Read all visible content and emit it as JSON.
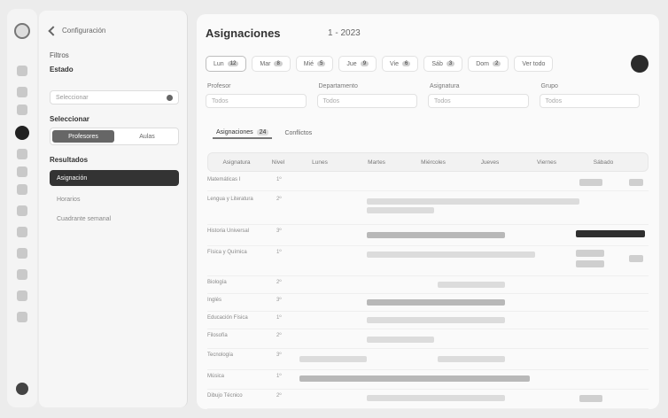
{
  "panel": {
    "back_label": "Configuración",
    "filters_label": "Filtros",
    "status_label": "Estado",
    "select_placeholder": "Seleccionar",
    "personal_label": "Seleccionar",
    "seg_left": "Profesores",
    "seg_right": "Aulas",
    "menu_title": "Resultados",
    "menu_items": [
      "Asignación",
      "Horarios",
      "Cuadrante semanal"
    ]
  },
  "main": {
    "title": "Asignaciones",
    "year": "1 - 2023",
    "tabs": [
      {
        "label": "Lun",
        "badge": "12"
      },
      {
        "label": "Mar",
        "badge": "8"
      },
      {
        "label": "Mié",
        "badge": "5"
      },
      {
        "label": "Jue",
        "badge": "9"
      },
      {
        "label": "Vie",
        "badge": "6"
      },
      {
        "label": "Sáb",
        "badge": "3"
      },
      {
        "label": "Dom",
        "badge": "2"
      },
      {
        "label": "Ver todo",
        "badge": ""
      }
    ],
    "filters": [
      {
        "label": "Profesor",
        "placeholder": "Todos"
      },
      {
        "label": "Departamento",
        "placeholder": "Todos"
      },
      {
        "label": "Asignatura",
        "placeholder": "Todos"
      },
      {
        "label": "Grupo",
        "placeholder": "Todos"
      }
    ],
    "subtabs": [
      {
        "label": "Asignaciones",
        "badge": "24"
      },
      {
        "label": "Conflictos",
        "badge": ""
      }
    ],
    "columns": [
      "Asignatura",
      "Nivel",
      "Lunes",
      "Martes",
      "Miércoles",
      "Jueves",
      "Viernes",
      "Sábado"
    ],
    "rows": [
      {
        "name": "Matemáticas I",
        "level": "1º"
      },
      {
        "name": "Lengua y Literatura",
        "level": "2º"
      },
      {
        "name": "Historia Universal",
        "level": "3º"
      },
      {
        "name": "Física y Química",
        "level": "1º"
      },
      {
        "name": "Biología",
        "level": "2º"
      },
      {
        "name": "Inglés",
        "level": "3º"
      },
      {
        "name": "Educación Física",
        "level": "1º"
      },
      {
        "name": "Filosofía",
        "level": "2º"
      },
      {
        "name": "Tecnología",
        "level": "3º"
      },
      {
        "name": "Música",
        "level": "1º"
      },
      {
        "name": "Dibujo Técnico",
        "level": "2º"
      }
    ]
  }
}
